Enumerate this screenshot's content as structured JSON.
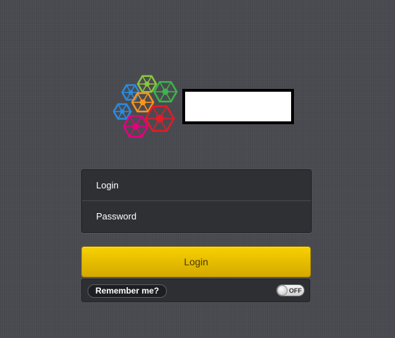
{
  "brand": {
    "logo_icon": "hexagon-cluster-logo-icon",
    "logo_colors": [
      "#2a8be0",
      "#8bc53f",
      "#3bb54a",
      "#f7941e",
      "#2a8be0",
      "#e6007e",
      "#e21c2a"
    ]
  },
  "form": {
    "login_placeholder": "Login",
    "password_placeholder": "Password",
    "submit_label": "Login",
    "remember_label": "Remember me?",
    "remember_toggle_state": "OFF"
  },
  "colors": {
    "accent": "#f2c800",
    "background": "#4a4b50"
  }
}
